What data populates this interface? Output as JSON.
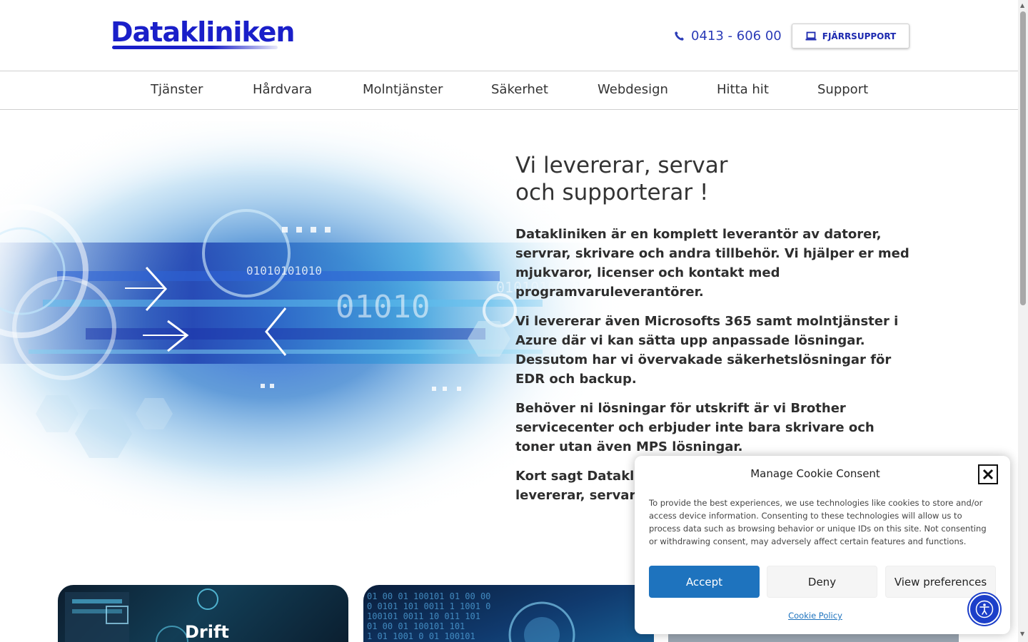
{
  "brand": {
    "logo_text": "Datakliniken",
    "color": "#1a1fc9"
  },
  "header": {
    "phone": "0413 - 606 00",
    "remote_support_label": "FJÄRRSUPPORT"
  },
  "nav": {
    "items": [
      {
        "label": "Tjänster"
      },
      {
        "label": "Hårdvara"
      },
      {
        "label": "Molntjänster"
      },
      {
        "label": "Säkerhet"
      },
      {
        "label": "Webdesign"
      },
      {
        "label": "Hitta hit"
      },
      {
        "label": "Support"
      }
    ]
  },
  "hero": {
    "title_line1": "Vi levererar, servar",
    "title_line2": "och supporterar !",
    "paragraphs": [
      "Datakliniken är en komplett leverantör av datorer, servrar, skrivare och andra tillbehör. Vi hjälper er med mjukvaror, licenser och kontakt med programvaruleverantörer.",
      "Vi levererar även Microsofts 365 samt molntjänster i Azure där vi kan sätta upp anpassade lösningar. Dessutom har vi övervakade säkerhetslösningar för EDR och backup.",
      "Behöver ni lösningar för utskrift är vi Brother servicecenter och erbjuder inte bara skrivare och toner utan även MPS lösningar.",
      "Kort sagt Datakliniken är en komplett IT-partner som levererar, servar och supporterar."
    ],
    "binary_text_1": "01010101010",
    "binary_text_2": "01010",
    "binary_text_3": "0101010101"
  },
  "cards": [
    {
      "title": "Drift"
    },
    {
      "title": ""
    },
    {
      "title": ""
    }
  ],
  "cookie": {
    "title": "Manage Cookie Consent",
    "body": "To provide the best experiences, we use technologies like cookies to store and/or access device information. Consenting to these technologies will allow us to process data such as browsing behavior or unique IDs on this site. Not consenting or withdrawing consent, may adversely affect certain features and functions.",
    "accept_label": "Accept",
    "deny_label": "Deny",
    "preferences_label": "View preferences",
    "policy_link": "Cookie Policy",
    "accept_color": "#1e73be"
  },
  "icons": {
    "phone": "phone-icon",
    "laptop": "laptop-icon",
    "close": "close-icon",
    "accessibility": "accessibility-icon"
  }
}
